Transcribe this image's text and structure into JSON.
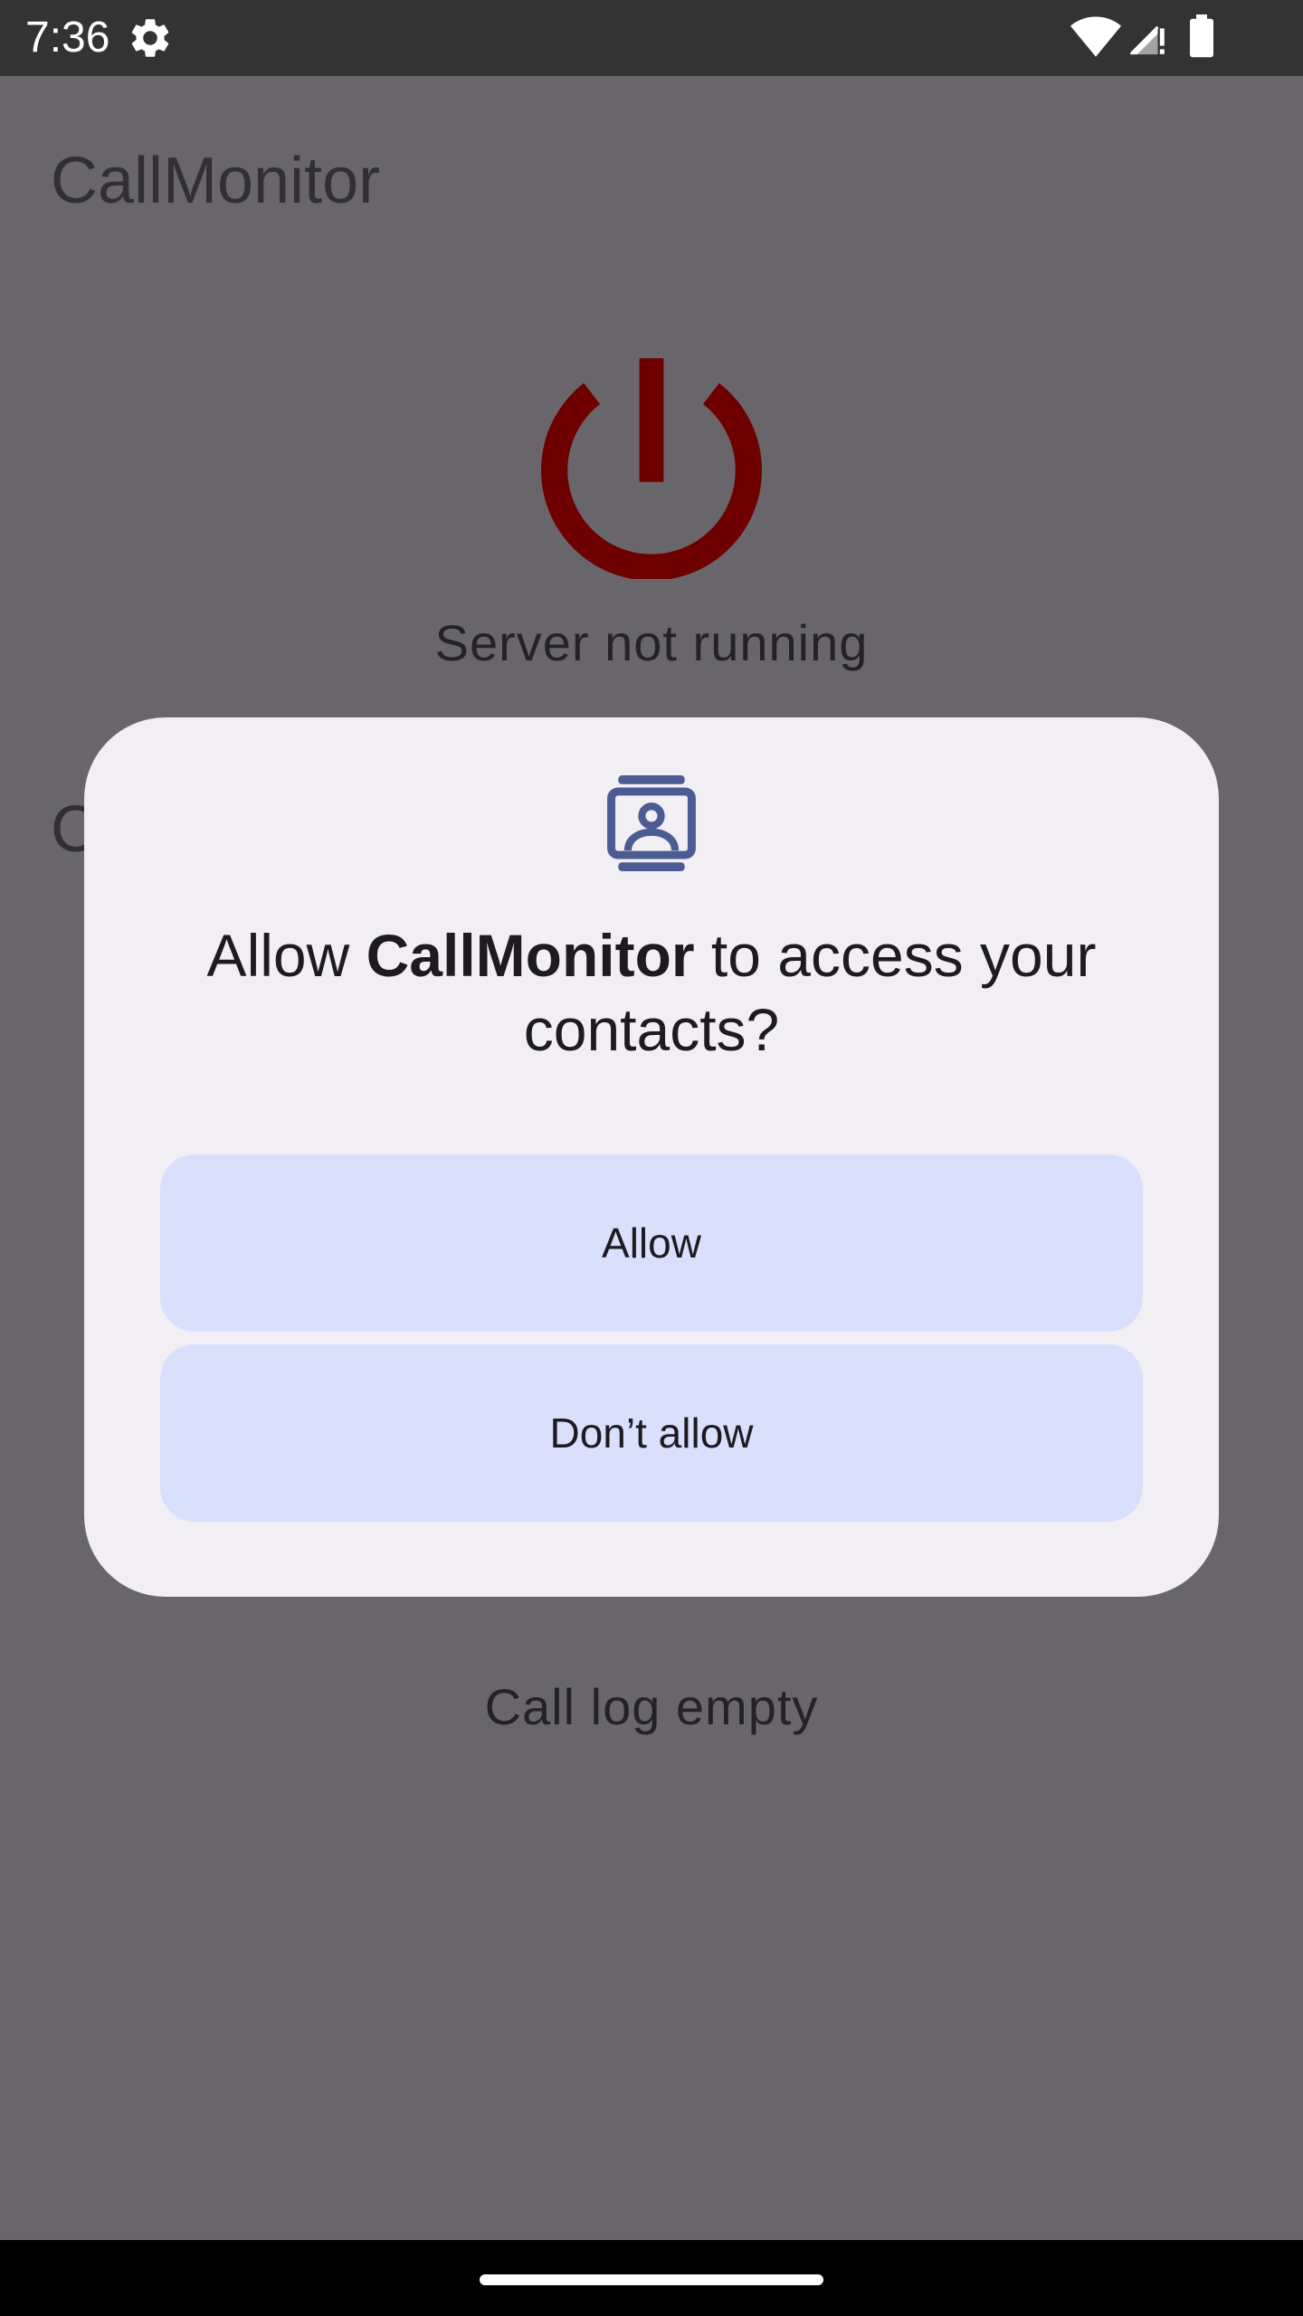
{
  "status_bar": {
    "time": "7:36",
    "icons": [
      "settings-gear-icon",
      "wifi-icon",
      "cell-signal-icon",
      "battery-icon"
    ]
  },
  "app": {
    "title": "CallMonitor",
    "power_icon_color": "#6e0000",
    "server_status": "Server not running",
    "partial_heading": "C",
    "call_log_status": "Call log empty"
  },
  "dialog": {
    "icon": "contacts-icon",
    "icon_color": "#4a5c92",
    "title_prefix": "Allow ",
    "app_name": "CallMonitor",
    "title_suffix": " to access your contacts?",
    "allow_label": "Allow",
    "deny_label": "Don’t allow"
  },
  "colors": {
    "scrim_background": "#68666a",
    "dialog_background": "#f2eff4",
    "button_background": "#d9e0fc"
  }
}
